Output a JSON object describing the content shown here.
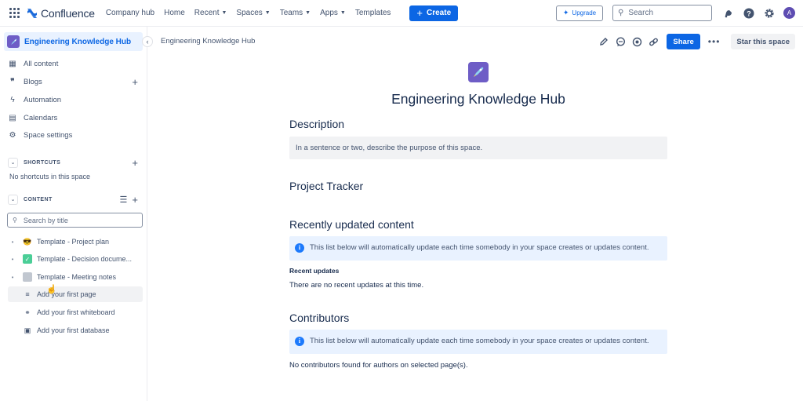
{
  "topbar": {
    "app_name": "Confluence",
    "nav": [
      {
        "label": "Company hub",
        "dropdown": false
      },
      {
        "label": "Home",
        "dropdown": false
      },
      {
        "label": "Recent",
        "dropdown": true
      },
      {
        "label": "Spaces",
        "dropdown": true
      },
      {
        "label": "Teams",
        "dropdown": true
      },
      {
        "label": "Apps",
        "dropdown": true
      },
      {
        "label": "Templates",
        "dropdown": false
      }
    ],
    "create_label": "Create",
    "upgrade_label": "Upgrade",
    "search_placeholder": "Search",
    "avatar_initial": "A",
    "icons": [
      "app-switcher-icon",
      "notifications-icon",
      "help-icon",
      "settings-icon"
    ]
  },
  "sidebar": {
    "space_name": "Engineering Knowledge Hub",
    "items": [
      {
        "label": "All content",
        "icon": "all-content-icon"
      },
      {
        "label": "Blogs",
        "icon": "quote-icon",
        "has_add": true
      },
      {
        "label": "Automation",
        "icon": "lightning-icon"
      },
      {
        "label": "Calendars",
        "icon": "calendar-icon"
      },
      {
        "label": "Space settings",
        "icon": "gear-icon"
      }
    ],
    "shortcuts": {
      "label": "SHORTCUTS",
      "empty_text": "No shortcuts in this space"
    },
    "content": {
      "label": "CONTENT",
      "search_placeholder": "Search by title",
      "tree": [
        {
          "label": "Template - Project plan",
          "emoji": "😎"
        },
        {
          "label": "Template - Decision docume...",
          "emoji": "✅"
        },
        {
          "label": "Template - Meeting notes",
          "emoji": "📄"
        }
      ],
      "add_actions": [
        {
          "label": "Add your first page",
          "icon": "page-icon"
        },
        {
          "label": "Add your first whiteboard",
          "icon": "whiteboard-icon"
        },
        {
          "label": "Add your first database",
          "icon": "database-icon"
        }
      ]
    }
  },
  "page": {
    "breadcrumb": "Engineering Knowledge Hub",
    "share_label": "Share",
    "more_label": "•••",
    "star_label": "Star this space",
    "title": "Engineering Knowledge Hub",
    "sections": {
      "description": {
        "heading": "Description",
        "placeholder": "In a sentence or two, describe the purpose of this space."
      },
      "project_tracker": {
        "heading": "Project Tracker"
      },
      "recent": {
        "heading": "Recently updated content",
        "info": "This list below will automatically update each time somebody in your space creates or updates content.",
        "subheading": "Recent updates",
        "empty": "There are no recent updates at this time."
      },
      "contributors": {
        "heading": "Contributors",
        "info": "This list below will automatically update each time somebody in your space creates or updates content.",
        "empty": "No contributors found for authors on selected page(s)."
      }
    }
  },
  "colors": {
    "brand_blue": "#0c66e4",
    "space_purple": "#6e5dc6",
    "info_bg": "#e9f2ff",
    "selected_bg": "#e9f2ff"
  }
}
